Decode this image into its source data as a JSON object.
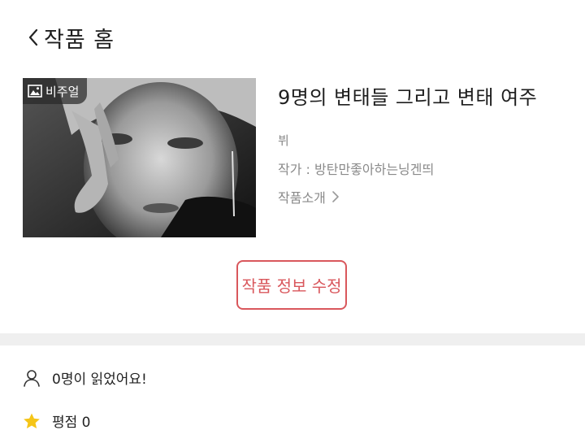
{
  "header": {
    "back_icon": "chevron-left-icon",
    "title": "작품 홈"
  },
  "cover": {
    "badge_icon": "image-icon",
    "badge_label": "비주얼"
  },
  "work": {
    "title": "9명의 변태들 그리고 변태 여주",
    "genre": "뷔",
    "author": "작가 : 방탄만좋아하는닝겐띄",
    "intro_link": "작품소개",
    "intro_icon": "chevron-right-icon"
  },
  "actions": {
    "edit_label": "작품 정보 수정",
    "accent_color": "#d9575c"
  },
  "stats": {
    "readers_icon": "person-icon",
    "readers_text": "0명이 읽었어요!",
    "rating_icon": "star-icon",
    "rating_text": "평점 0",
    "star_color": "#f5c518"
  }
}
